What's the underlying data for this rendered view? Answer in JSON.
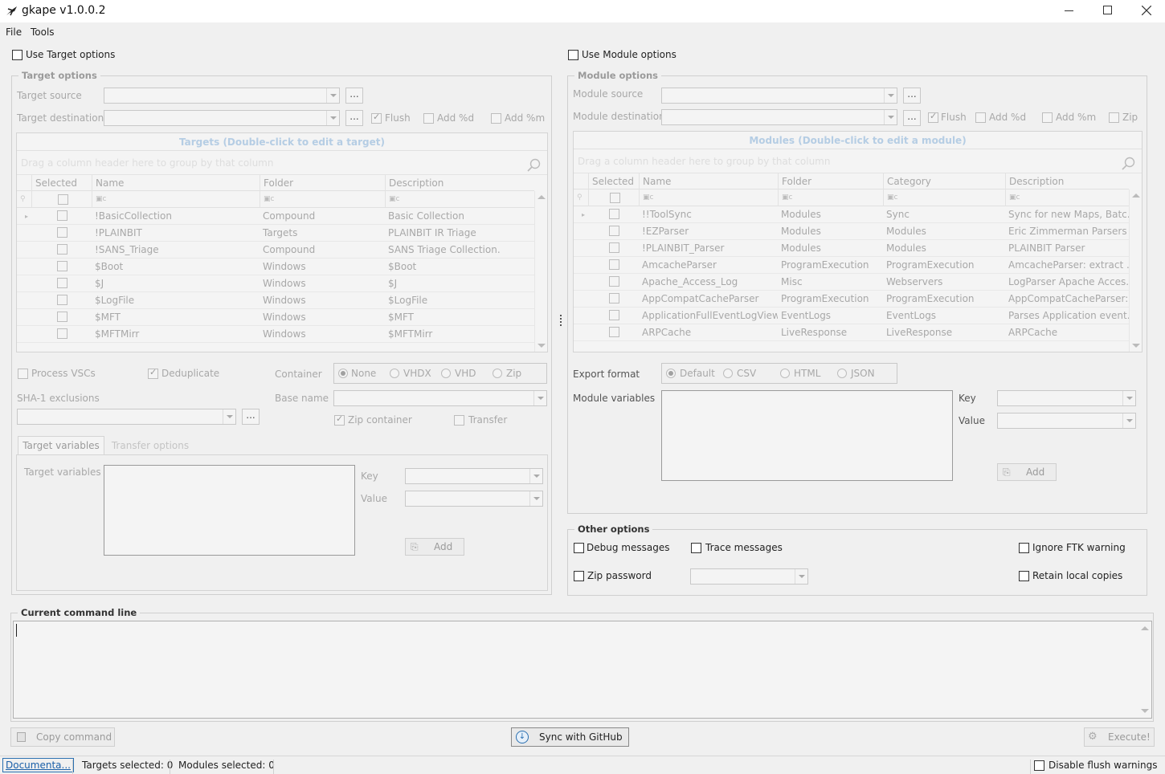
{
  "window": {
    "title": "gkape v1.0.0.2"
  },
  "menu": [
    "File",
    "Tools"
  ],
  "target": {
    "use_label": "Use Target options",
    "group_label": "Target options",
    "source_label": "Target source",
    "dest_label": "Target destination",
    "browse": "...",
    "flush": "Flush",
    "add_d": "Add %d",
    "add_m": "Add %m",
    "grid_title": "Targets (Double-click to edit a target)",
    "drag_hint": "Drag a column header here to group by that column",
    "columns": [
      "Selected",
      "Name",
      "Folder",
      "Description"
    ],
    "rows": [
      {
        "name": "!BasicCollection",
        "folder": "Compound",
        "desc": "Basic Collection"
      },
      {
        "name": "!PLAINBIT",
        "folder": "Targets",
        "desc": "PLAINBIT IR Triage"
      },
      {
        "name": "!SANS_Triage",
        "folder": "Compound",
        "desc": "SANS Triage Collection."
      },
      {
        "name": "$Boot",
        "folder": "Windows",
        "desc": "$Boot"
      },
      {
        "name": "$J",
        "folder": "Windows",
        "desc": "$J"
      },
      {
        "name": "$LogFile",
        "folder": "Windows",
        "desc": "$LogFile"
      },
      {
        "name": "$MFT",
        "folder": "Windows",
        "desc": "$MFT"
      },
      {
        "name": "$MFTMirr",
        "folder": "Windows",
        "desc": "$MFTMirr"
      }
    ],
    "process_vscs": "Process VSCs",
    "dedupe": "Deduplicate",
    "container_label": "Container",
    "container_opts": [
      "None",
      "VHDX",
      "VHD",
      "Zip"
    ],
    "sha1": "SHA-1 exclusions",
    "base_name": "Base name",
    "zip_container": "Zip container",
    "transfer": "Transfer",
    "tabs": [
      "Target variables",
      "Transfer options"
    ],
    "vars_label": "Target variables",
    "key": "Key",
    "value": "Value",
    "add": "Add"
  },
  "module": {
    "use_label": "Use Module options",
    "group_label": "Module options",
    "source_label": "Module source",
    "dest_label": "Module destination",
    "browse": "...",
    "flush": "Flush",
    "add_d": "Add %d",
    "add_m": "Add %m",
    "zip": "Zip",
    "grid_title": "Modules (Double-click to edit a module)",
    "drag_hint": "Drag a column header here to group by that column",
    "columns": [
      "Selected",
      "Name",
      "Folder",
      "Category",
      "Description"
    ],
    "rows": [
      {
        "name": "!!ToolSync",
        "folder": "Modules",
        "cat": "Sync",
        "desc": "Sync for new Maps, Batc..."
      },
      {
        "name": "!EZParser",
        "folder": "Modules",
        "cat": "Modules",
        "desc": "Eric Zimmerman Parsers"
      },
      {
        "name": "!PLAINBIT_Parser",
        "folder": "Modules",
        "cat": "Modules",
        "desc": "PLAINBIT Parser"
      },
      {
        "name": "AmcacheParser",
        "folder": "ProgramExecution",
        "cat": "ProgramExecution",
        "desc": "AmcacheParser: extract ..."
      },
      {
        "name": "Apache_Access_Log",
        "folder": "Misc",
        "cat": "Webservers",
        "desc": "LogParser Apache Acces..."
      },
      {
        "name": "AppCompatCacheParser",
        "folder": "ProgramExecution",
        "cat": "ProgramExecution",
        "desc": "AppCompatCacheParser:..."
      },
      {
        "name": "ApplicationFullEventLogView",
        "folder": "EventLogs",
        "cat": "EventLogs",
        "desc": "Parses Application event..."
      },
      {
        "name": "ARPCache",
        "folder": "LiveResponse",
        "cat": "LiveResponse",
        "desc": "ARPCache"
      }
    ],
    "export_label": "Export format",
    "export_opts": [
      "Default",
      "CSV",
      "HTML",
      "JSON"
    ],
    "vars_label": "Module variables",
    "key": "Key",
    "value": "Value",
    "add": "Add"
  },
  "other": {
    "group_label": "Other options",
    "debug": "Debug messages",
    "trace": "Trace messages",
    "ignore_ftk": "Ignore FTK warning",
    "zip_pw": "Zip password",
    "retain": "Retain local copies"
  },
  "cmdline": {
    "group_label": "Current command line"
  },
  "buttons": {
    "copy": "Copy command",
    "sync": "Sync with GitHub",
    "execute": "Execute!"
  },
  "status": {
    "docs": "Documenta...",
    "targets": "Targets selected: 0",
    "modules": "Modules selected: 0",
    "flush_warn": "Disable flush warnings"
  }
}
